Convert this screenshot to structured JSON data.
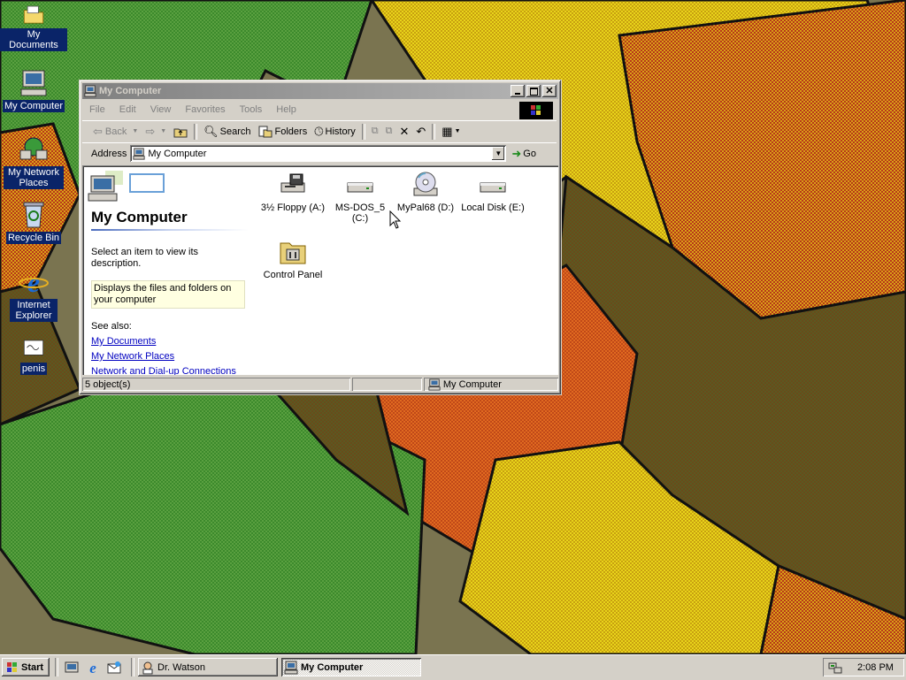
{
  "desktop": {
    "icons": [
      {
        "label": "My Documents"
      },
      {
        "label": "My Computer"
      },
      {
        "label": "My Network Places"
      },
      {
        "label": "Recycle Bin"
      },
      {
        "label": "Internet Explorer"
      },
      {
        "label": "penis"
      }
    ]
  },
  "window": {
    "title": "My Computer",
    "menu": [
      "File",
      "Edit",
      "View",
      "Favorites",
      "Tools",
      "Help"
    ],
    "toolbar": {
      "back": "Back",
      "search": "Search",
      "folders": "Folders",
      "history": "History"
    },
    "address": {
      "label": "Address",
      "value": "My Computer",
      "go": "Go"
    },
    "left_pane": {
      "title": "My Computer",
      "prompt": "Select an item to view its description.",
      "info": "Displays the files and folders on your computer",
      "see_also": "See also:",
      "links": [
        "My Documents",
        "My Network Places",
        "Network and Dial-up Connections"
      ]
    },
    "items": [
      {
        "label": "3½ Floppy (A:)",
        "icon": "floppy-drive-icon"
      },
      {
        "label": "MS-DOS_5 (C:)",
        "icon": "hard-disk-icon"
      },
      {
        "label": "MyPal68 (D:)",
        "icon": "cd-drive-icon"
      },
      {
        "label": "Local Disk (E:)",
        "icon": "hard-disk-icon"
      },
      {
        "label": "Control Panel",
        "icon": "control-panel-icon"
      }
    ],
    "status": {
      "count": "5 object(s)",
      "zone": "My Computer"
    }
  },
  "taskbar": {
    "start": "Start",
    "tasks": [
      {
        "label": "Dr. Watson",
        "active": false
      },
      {
        "label": "My Computer",
        "active": true
      }
    ],
    "clock": "2:08 PM"
  },
  "colors": {
    "desktop_selection": "#0a2468",
    "inactive_title": "#808080",
    "face": "#d4d0c8",
    "link": "#0000c0"
  }
}
